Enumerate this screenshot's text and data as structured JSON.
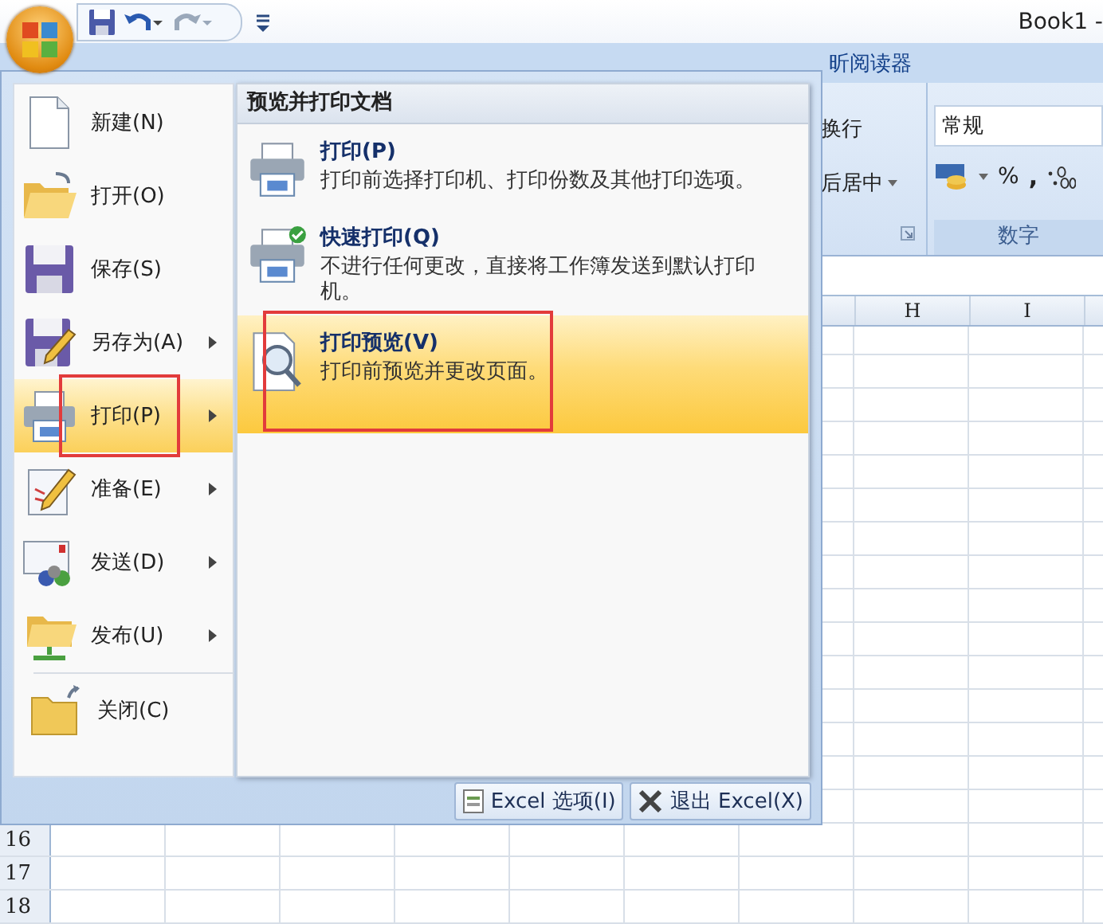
{
  "title_bar": {
    "title": "Book1 -"
  },
  "ribbon": {
    "tab_fragment": "昕阅读器",
    "alignment_group": {
      "wrap_text": "换行",
      "merge_center": "后居中"
    },
    "number_group": {
      "format": "常规",
      "percent": "%",
      "comma": ",",
      "label": "数字"
    }
  },
  "sheet": {
    "columns": [
      "H",
      "I"
    ],
    "rows": [
      "16",
      "17",
      "18"
    ]
  },
  "office_menu": {
    "items": [
      {
        "label": "新建(N)",
        "selected": false,
        "submenu": false,
        "annotated": false
      },
      {
        "label": "打开(O)",
        "selected": false,
        "submenu": false,
        "annotated": false
      },
      {
        "label": "保存(S)",
        "selected": false,
        "submenu": false,
        "annotated": false
      },
      {
        "label": "另存为(A)",
        "selected": false,
        "submenu": true,
        "annotated": false
      },
      {
        "label": "打印(P)",
        "selected": true,
        "submenu": true,
        "annotated": true
      },
      {
        "label": "准备(E)",
        "selected": false,
        "submenu": true,
        "annotated": false
      },
      {
        "label": "发送(D)",
        "selected": false,
        "submenu": true,
        "annotated": false
      },
      {
        "label": "发布(U)",
        "selected": false,
        "submenu": true,
        "annotated": false
      },
      {
        "label": "关闭(C)",
        "selected": false,
        "submenu": false,
        "annotated": false
      }
    ],
    "pane": {
      "title": "预览并打印文档",
      "items": [
        {
          "title": "打印(P)",
          "description": "打印前选择打印机、打印份数及其他打印选项。",
          "highlighted": false,
          "annotated": false
        },
        {
          "title": "快速打印(Q)",
          "description": "不进行任何更改，直接将工作簿发送到默认打印机。",
          "highlighted": false,
          "annotated": false
        },
        {
          "title": "打印预览(V)",
          "description": "打印前预览并更改页面。",
          "highlighted": true,
          "annotated": true
        }
      ]
    },
    "buttons": [
      {
        "label": "Excel 选项(I)"
      },
      {
        "label": "退出 Excel(X)"
      }
    ]
  }
}
